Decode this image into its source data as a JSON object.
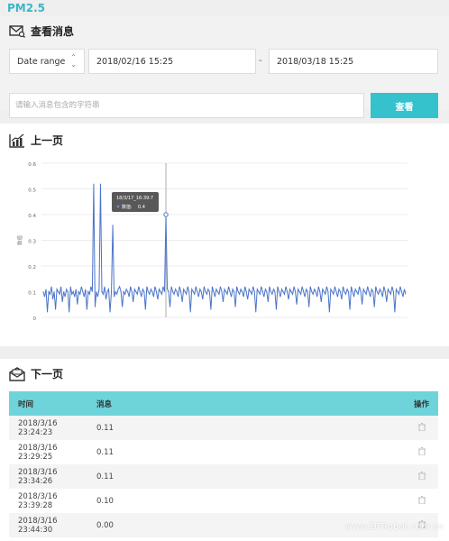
{
  "page": {
    "title": "PM2.5"
  },
  "query": {
    "heading": "查看消息",
    "date_range_label": "Date range",
    "start": "2018/02/16 15:25",
    "separator": "-",
    "end": "2018/03/18 15:25",
    "keyword_placeholder": "请输入消息包含的字符串",
    "search_label": "查看"
  },
  "chart_panel": {
    "heading": "上一页"
  },
  "table_panel": {
    "heading": "下一页",
    "columns": {
      "time": "时间",
      "message": "消息",
      "action": "操作"
    },
    "rows": [
      {
        "time": "2018/3/16 23:24:23",
        "value": "0.11"
      },
      {
        "time": "2018/3/16 23:29:25",
        "value": "0.11"
      },
      {
        "time": "2018/3/16 23:34:26",
        "value": "0.11"
      },
      {
        "time": "2018/3/16 23:39:28",
        "value": "0.10"
      },
      {
        "time": "2018/3/16 23:44:30",
        "value": "0.00"
      }
    ]
  },
  "watermark": "www.DFRobot.com.cn",
  "colors": {
    "accent": "#35c2cd",
    "header_row": "#6fd3da",
    "line": "#4a74c9"
  },
  "chart_data": {
    "type": "line",
    "ylabel": "数值",
    "yticks": [
      "0",
      "0.1",
      "0.2",
      "0.3",
      "0.4",
      "0.5",
      "0.6"
    ],
    "ylim": [
      0,
      0.6
    ],
    "grid": true,
    "tooltip": {
      "time": "18/3/17_16:39:7",
      "series": "数值",
      "value": "0.4"
    },
    "series": [
      {
        "values": [
          0.1,
          0.08,
          0.11,
          0.02,
          0.1,
          0.09,
          0.12,
          0.07,
          0.1,
          0.03,
          0.11,
          0.1,
          0.09,
          0.12,
          0.06,
          0.1,
          0.08,
          0.11,
          0.1,
          0.02,
          0.12,
          0.09,
          0.1,
          0.08,
          0.11,
          0.05,
          0.1,
          0.09,
          0.12,
          0.1,
          0.08,
          0.11,
          0.03,
          0.1,
          0.09,
          0.12,
          0.1,
          0.52,
          0.04,
          0.1,
          0.08,
          0.11,
          0.52,
          0.1,
          0.09,
          0.12,
          0.07,
          0.1,
          0.11,
          0.02,
          0.1,
          0.36,
          0.08,
          0.1,
          0.09,
          0.11,
          0.12,
          0.1,
          0.04,
          0.1,
          0.09,
          0.11,
          0.1,
          0.08,
          0.12,
          0.1,
          0.06,
          0.11,
          0.1,
          0.09,
          0.12,
          0.1,
          0.08,
          0.11,
          0.1,
          0.03,
          0.12,
          0.1,
          0.09,
          0.11,
          0.1,
          0.08,
          0.12,
          0.1,
          0.07,
          0.11,
          0.1,
          0.09,
          0.12,
          0.1,
          0.4,
          0.11,
          0.1,
          0.04,
          0.12,
          0.1,
          0.09,
          0.11,
          0.1,
          0.08,
          0.12,
          0.1,
          0.06,
          0.11,
          0.1,
          0.09,
          0.12,
          0.1,
          0.02,
          0.11,
          0.1,
          0.09,
          0.12,
          0.1,
          0.08,
          0.11,
          0.1,
          0.07,
          0.12,
          0.1,
          0.09,
          0.11,
          0.1,
          0.03,
          0.12,
          0.1,
          0.08,
          0.11,
          0.1,
          0.09,
          0.12,
          0.1,
          0.06,
          0.11,
          0.1,
          0.09,
          0.12,
          0.1,
          0.08,
          0.11,
          0.1,
          0.04,
          0.12,
          0.1,
          0.09,
          0.11,
          0.1,
          0.08,
          0.12,
          0.1,
          0.07,
          0.11,
          0.1,
          0.09,
          0.12,
          0.1,
          0.02,
          0.11,
          0.1,
          0.09,
          0.12,
          0.1,
          0.08,
          0.11,
          0.1,
          0.06,
          0.12,
          0.1,
          0.09,
          0.11,
          0.1,
          0.03,
          0.12,
          0.1,
          0.08,
          0.11,
          0.1,
          0.09,
          0.12,
          0.1,
          0.07,
          0.11,
          0.1,
          0.09,
          0.12,
          0.1,
          0.05,
          0.11,
          0.1,
          0.09,
          0.12,
          0.1,
          0.08,
          0.11,
          0.1,
          0.04,
          0.12,
          0.1,
          0.09,
          0.11,
          0.1,
          0.08,
          0.12,
          0.1,
          0.06,
          0.11,
          0.1,
          0.09,
          0.12,
          0.1,
          0.02,
          0.11,
          0.1,
          0.09,
          0.12,
          0.1,
          0.08,
          0.11,
          0.1,
          0.07,
          0.12,
          0.1,
          0.09,
          0.11,
          0.1,
          0.03,
          0.12,
          0.1,
          0.08,
          0.11,
          0.1,
          0.09,
          0.12,
          0.1,
          0.05,
          0.11,
          0.1,
          0.09,
          0.12,
          0.1,
          0.08,
          0.11,
          0.1,
          0.04,
          0.12,
          0.1,
          0.09,
          0.11,
          0.1,
          0.08,
          0.12,
          0.1,
          0.06,
          0.11,
          0.1,
          0.09,
          0.12,
          0.1,
          0.02,
          0.11,
          0.1,
          0.09,
          0.12,
          0.1,
          0.08,
          0.11,
          0.09
        ]
      }
    ]
  }
}
